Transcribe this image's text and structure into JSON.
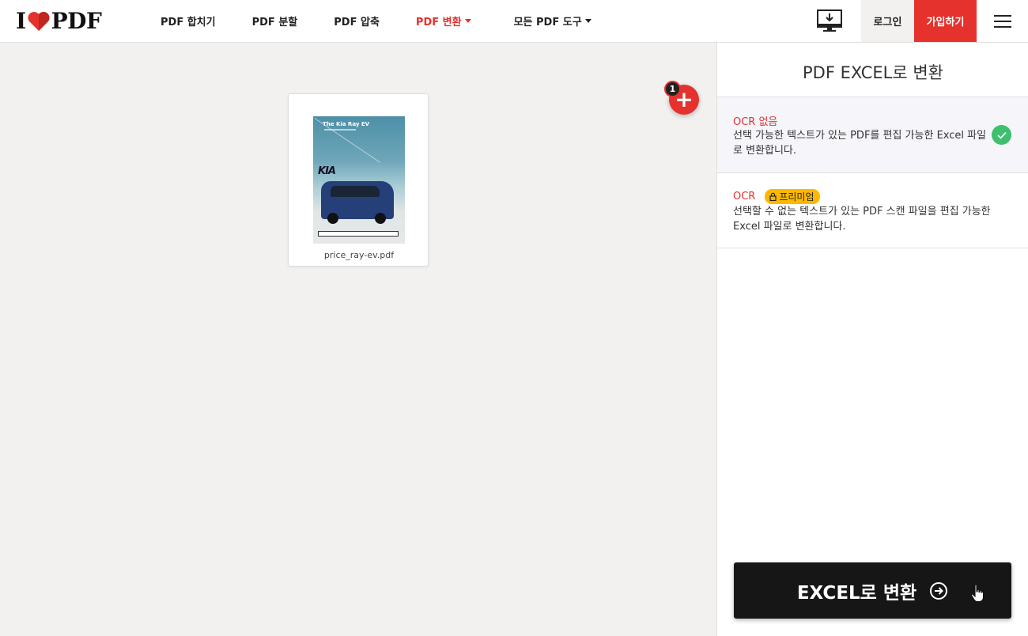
{
  "header": {
    "logo_left": "I",
    "logo_right": "PDF",
    "nav": [
      {
        "label": "PDF 합치기"
      },
      {
        "label": "PDF 분할"
      },
      {
        "label": "PDF 압축"
      },
      {
        "label": "PDF 변환",
        "active": true,
        "dropdown": true
      },
      {
        "label": "모든 PDF 도구",
        "dropdown": true
      }
    ],
    "login_label": "로그인",
    "signup_label": "가입하기",
    "icons": {
      "desktop": "desktop-download-icon",
      "menu": "hamburger-menu-icon"
    }
  },
  "workspace": {
    "file": {
      "name": "price_ray-ev.pdf",
      "thumb_title": "The Kia Ray EV",
      "thumb_brand": "KIA"
    },
    "add_count": "1",
    "add_symbol": "+"
  },
  "sidebar": {
    "title": "PDF EXCEL로 변환",
    "options": [
      {
        "label": "OCR 없음",
        "desc": "선택 가능한 텍스트가 있는 PDF를 편집 가능한 Excel 파일로 변환합니다.",
        "selected": true
      },
      {
        "label": "OCR",
        "badge": "프리미엄",
        "desc": "선택할 수 없는 텍스트가 있는 PDF 스캔 파일을 편집 가능한 Excel 파일로 변환합니다."
      }
    ],
    "convert_label": "EXCEL로 변환"
  },
  "colors": {
    "brand_red": "#e5322d",
    "success_green": "#3fbf6f",
    "premium_yellow": "#ffb800",
    "dark_button": "#161616"
  }
}
